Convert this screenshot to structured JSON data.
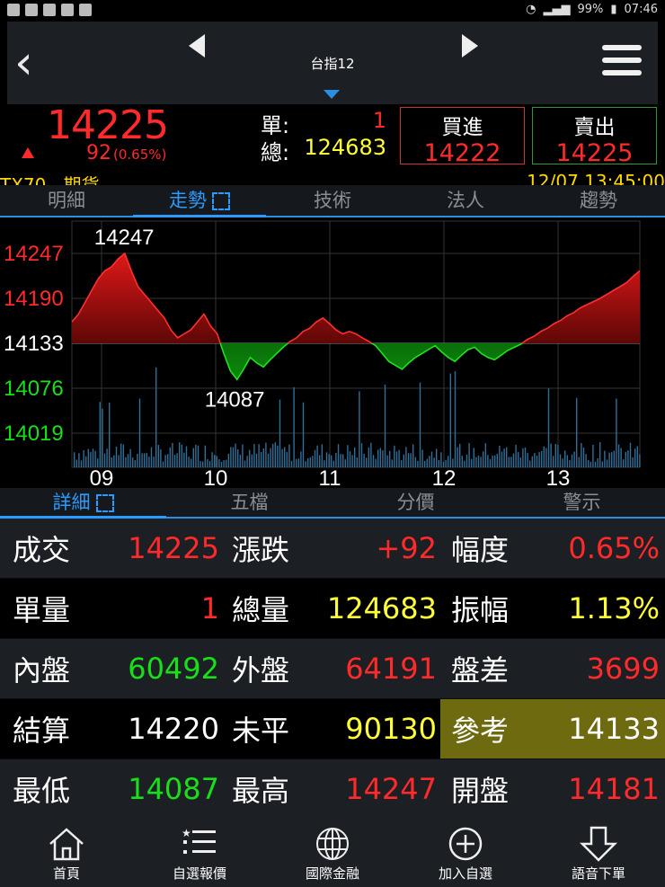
{
  "statusbar": {
    "battery": "99%",
    "time": "07:46"
  },
  "nav": {
    "title": "台指12"
  },
  "quote": {
    "price": "14225",
    "change": "92",
    "change_pct": "(0.65%)",
    "unit_label": "單:",
    "unit_value": "1",
    "total_label": "總:",
    "total_value": "124683",
    "buy_label": "買進",
    "buy_value": "14222",
    "sell_label": "賣出",
    "sell_value": "14225",
    "symbol": "TX70",
    "type": "期貨",
    "datetime": "12/07 13:45:00"
  },
  "tabs": [
    "明細",
    "走勢",
    "技術",
    "法人",
    "趨勢"
  ],
  "detail_tabs": [
    "詳細",
    "五檔",
    "分價",
    "警示"
  ],
  "chart_data": {
    "type": "area",
    "y_ticks": [
      "14247",
      "14190",
      "14133",
      "14076",
      "14019"
    ],
    "x_ticks": [
      "09",
      "10",
      "11",
      "12",
      "13"
    ],
    "reference": 14133,
    "high_label": "14247",
    "low_label": "14087",
    "ylim": [
      14019,
      14247
    ],
    "prices": [
      14160,
      14170,
      14185,
      14200,
      14215,
      14225,
      14230,
      14240,
      14247,
      14225,
      14205,
      14195,
      14185,
      14175,
      14165,
      14150,
      14140,
      14145,
      14150,
      14160,
      14170,
      14155,
      14145,
      14120,
      14098,
      14087,
      14100,
      14115,
      14108,
      14103,
      14112,
      14120,
      14128,
      14135,
      14140,
      14148,
      14152,
      14160,
      14165,
      14158,
      14150,
      14145,
      14148,
      14145,
      14140,
      14135,
      14130,
      14120,
      14110,
      14105,
      14100,
      14108,
      14115,
      14120,
      14125,
      14130,
      14122,
      14115,
      14110,
      14118,
      14125,
      14128,
      14120,
      14115,
      14112,
      14118,
      14124,
      14128,
      14132,
      14138,
      14142,
      14148,
      14152,
      14158,
      14162,
      14168,
      14172,
      14178,
      14182,
      14186,
      14190,
      14195,
      14200,
      14205,
      14210,
      14218,
      14225
    ]
  },
  "grid": [
    [
      {
        "t": "成交"
      },
      {
        "t": "14225",
        "c": "red"
      },
      {
        "t": "漲跌"
      },
      {
        "t": "+92",
        "c": "red"
      },
      {
        "t": "幅度"
      },
      {
        "t": "0.65%",
        "c": "red"
      }
    ],
    [
      {
        "t": "單量"
      },
      {
        "t": "1",
        "c": "red"
      },
      {
        "t": "總量"
      },
      {
        "t": "124683",
        "c": "yellow"
      },
      {
        "t": "振幅"
      },
      {
        "t": "1.13%",
        "c": "yellow"
      }
    ],
    [
      {
        "t": "內盤"
      },
      {
        "t": "60492",
        "c": "green"
      },
      {
        "t": "外盤"
      },
      {
        "t": "64191",
        "c": "red"
      },
      {
        "t": "盤差"
      },
      {
        "t": "3699",
        "c": "red"
      }
    ],
    [
      {
        "t": "結算"
      },
      {
        "t": "14220",
        "c": "white"
      },
      {
        "t": "未平"
      },
      {
        "t": "90130",
        "c": "yellow"
      },
      {
        "t": "參考"
      },
      {
        "t": "14133",
        "c": "white"
      }
    ],
    [
      {
        "t": "最低"
      },
      {
        "t": "14087",
        "c": "green"
      },
      {
        "t": "最高"
      },
      {
        "t": "14247",
        "c": "red"
      },
      {
        "t": "開盤"
      },
      {
        "t": "14181",
        "c": "red"
      }
    ]
  ],
  "bottom_nav": [
    "首頁",
    "自選報價",
    "國際金融",
    "加入自選",
    "語音下單"
  ]
}
